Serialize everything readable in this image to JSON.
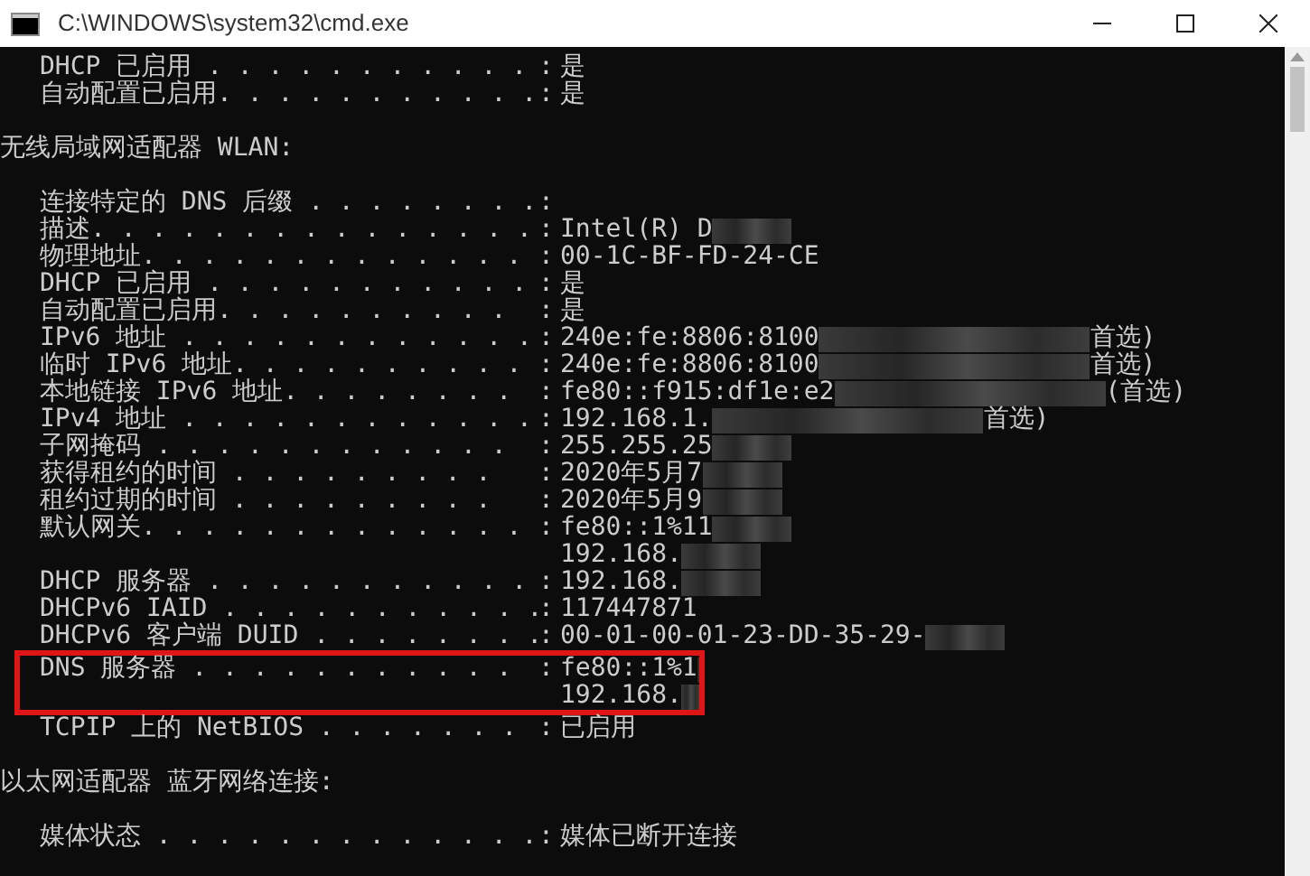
{
  "window": {
    "title": "C:\\WINDOWS\\system32\\cmd.exe"
  },
  "lines": [
    {
      "kind": "entry",
      "label": "DHCP 已启用 . . . . . . . . . . .",
      "separator": ":",
      "value": "是",
      "redacted": false,
      "highlighted": false
    },
    {
      "kind": "entry",
      "label": "自动配置已启用. . . . . . . . . . .",
      "separator": ":",
      "value": "是",
      "redacted": false,
      "highlighted": false
    },
    {
      "kind": "blank"
    },
    {
      "kind": "header",
      "text": "无线局域网适配器 WLAN:"
    },
    {
      "kind": "blank"
    },
    {
      "kind": "entry",
      "label": "连接特定的 DNS 后缀 . . . . . . . .",
      "separator": ":",
      "redacted": false,
      "highlighted": false
    },
    {
      "kind": "entry",
      "label": "描述. . . . . . . . . . . . . . .",
      "separator": ":",
      "value": "Intel(R) D",
      "redacted": true,
      "highlighted": false
    },
    {
      "kind": "entry",
      "label": "物理地址. . . . . . . . . . . . .",
      "separator": ":",
      "value": "00-1C-BF-FD-24-CE",
      "redacted": false,
      "highlighted": false
    },
    {
      "kind": "entry",
      "label": "DHCP 已启用 . . . . . . . . . . .",
      "separator": ":",
      "value": "是",
      "redacted": false,
      "highlighted": false
    },
    {
      "kind": "entry",
      "label": "自动配置已启用. . . . . . . . . .",
      "separator": ":",
      "value": "是",
      "redacted": false,
      "highlighted": false
    },
    {
      "kind": "entry",
      "label": "IPv6 地址 . . . . . . . . . . . .",
      "separator": ":",
      "value": "240e:fe:8806:8100",
      "redacted": true,
      "value_after": "首选)",
      "highlighted": false
    },
    {
      "kind": "entry",
      "label": "临时 IPv6 地址. . . . . . . . . .",
      "separator": ":",
      "value": "240e:fe:8806:8100",
      "redacted": true,
      "value_after": "首选)",
      "highlighted": false
    },
    {
      "kind": "entry",
      "label": "本地链接 IPv6 地址. . . . . . . .",
      "separator": ":",
      "value": "fe80::f915:df1e:e2",
      "redacted": true,
      "value_after": "(首选)",
      "highlighted": false
    },
    {
      "kind": "entry",
      "label": "IPv4 地址 . . . . . . . . . . . .",
      "separator": ":",
      "value": "192.168.1.",
      "redacted": true,
      "value_after": "首选)",
      "highlighted": false
    },
    {
      "kind": "entry",
      "label": "子网掩码 . . . . . . . . . . . .",
      "separator": ":",
      "value": "255.255.25",
      "redacted": true,
      "highlighted": false
    },
    {
      "kind": "entry",
      "label": "获得租约的时间 . . . . . . . . .",
      "separator": ":",
      "value": "2020年5月7",
      "redacted": true,
      "highlighted": false
    },
    {
      "kind": "entry",
      "label": "租约过期的时间 . . . . . . . . .",
      "separator": ":",
      "value": "2020年5月9",
      "redacted": true,
      "highlighted": false
    },
    {
      "kind": "entry",
      "label": "默认网关. . . . . . . . . . . . .",
      "separator": ":",
      "value": "fe80::1%11",
      "redacted": true,
      "highlighted": false
    },
    {
      "kind": "continuation",
      "value": "192.168.",
      "redacted": true,
      "highlighted": false
    },
    {
      "kind": "entry",
      "label": "DHCP 服务器 . . . . . . . . . . .",
      "separator": ":",
      "value": "192.168.",
      "redacted": true,
      "highlighted": false
    },
    {
      "kind": "entry",
      "label": "DHCPv6 IAID . . . . . . . . . . .",
      "separator": ":",
      "value": "117447871",
      "redacted": false,
      "highlighted": false
    },
    {
      "kind": "entry",
      "label": "DHCPv6 客户端 DUID . . . . . . . .",
      "separator": ":",
      "value": "00-01-00-01-23-DD-35-29-",
      "redacted": true,
      "highlighted": false
    },
    {
      "kind": "entry",
      "label": "DNS 服务器 . . . . . . . . . . .",
      "separator": ":",
      "value": "fe80::1%1",
      "redacted": true,
      "highlighted": true
    },
    {
      "kind": "continuation",
      "value": "192.168.",
      "redacted": true,
      "highlighted": true
    },
    {
      "kind": "entry",
      "label": "TCPIP 上的 NetBIOS . . . . . . .",
      "separator": ":",
      "value": "已启用",
      "redacted": false,
      "highlighted": false
    },
    {
      "kind": "blank"
    },
    {
      "kind": "header",
      "text": "以太网适配器 蓝牙网络连接:"
    },
    {
      "kind": "blank"
    },
    {
      "kind": "entry",
      "label": "媒体状态 . . . . . . . . . . . . .",
      "separator": ":",
      "value": "媒体已断开连接",
      "redacted": false,
      "highlighted": false
    }
  ]
}
